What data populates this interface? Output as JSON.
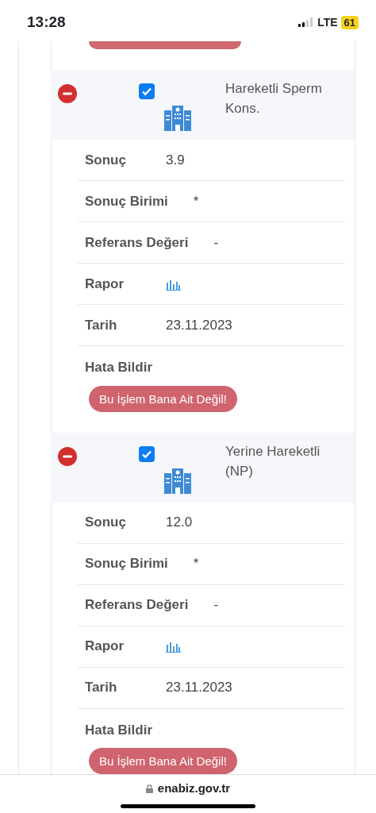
{
  "status_bar": {
    "time": "13:28",
    "network": "LTE",
    "battery": "61"
  },
  "records": [
    {
      "title": "Hareketli Sperm Kons.",
      "checked": true,
      "fields": [
        {
          "kind": "text",
          "label": "Sonuç",
          "value": "3.9"
        },
        {
          "kind": "text",
          "label": "Sonuç Birimi",
          "value": "*"
        },
        {
          "kind": "text",
          "label": "Referans Değeri",
          "value": "-"
        },
        {
          "kind": "chart",
          "label": "Rapor"
        },
        {
          "kind": "text",
          "label": "Tarih",
          "value": "23.11.2023"
        }
      ],
      "report_label": "Hata Bildir",
      "report_button": "Bu İşlem Bana Ait Değil!"
    },
    {
      "title": "Yerine Hareketli (NP)",
      "checked": true,
      "fields": [
        {
          "kind": "text",
          "label": "Sonuç",
          "value": "12.0"
        },
        {
          "kind": "text",
          "label": "Sonuç Birimi",
          "value": "*"
        },
        {
          "kind": "text",
          "label": "Referans Değeri",
          "value": "-"
        },
        {
          "kind": "chart",
          "label": "Rapor"
        },
        {
          "kind": "text",
          "label": "Tarih",
          "value": "23.11.2023"
        }
      ],
      "report_label": "Hata Bildir",
      "report_button": "Bu İşlem Bana Ait Değil!"
    }
  ],
  "address_bar": {
    "url": "enabiz.gov.tr"
  }
}
